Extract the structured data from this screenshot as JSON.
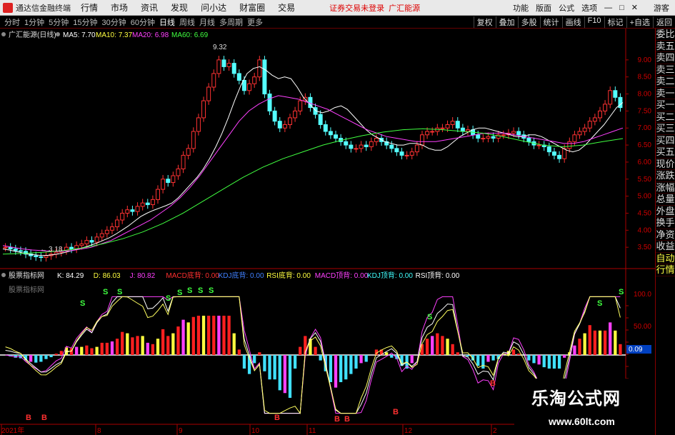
{
  "menubar": {
    "app_title": "通达信金融终端",
    "items": [
      "行情",
      "市场",
      "资讯",
      "发现",
      "问小达",
      "财富圈",
      "交易"
    ],
    "notice": "证券交易未登录",
    "notice2": "广汇能源",
    "right_items": [
      "功能",
      "版面",
      "公式",
      "选项"
    ],
    "guest": "游客"
  },
  "periodbar": {
    "periods": [
      "分时",
      "1分钟",
      "5分钟",
      "15分钟",
      "30分钟",
      "60分钟",
      "日线",
      "周线",
      "月线",
      "多周期",
      "更多"
    ],
    "active": "日线",
    "tools": [
      "复权",
      "叠加",
      "多股",
      "统计",
      "画线",
      "F10",
      "标记",
      "+自选",
      "返回"
    ]
  },
  "main_chart": {
    "stock_label": "广汇能源(日线)",
    "ma": [
      {
        "name": "MA5",
        "value": "7.70",
        "color": "#ffffff"
      },
      {
        "name": "MA10",
        "value": "7.37",
        "color": "#ffff40"
      },
      {
        "name": "MA20",
        "value": "6.98",
        "color": "#ff40ff"
      },
      {
        "name": "MA60",
        "value": "6.69",
        "color": "#40ff40"
      }
    ],
    "high_label": "9.32",
    "low_label": "3.18",
    "y_ticks": [
      "9.00",
      "8.50",
      "8.00",
      "7.50",
      "7.00",
      "6.50",
      "6.00",
      "5.50",
      "5.00",
      "4.50",
      "4.00",
      "3.50"
    ]
  },
  "indicator": {
    "name_label": "股票指标网",
    "sub_label": "股票指标网",
    "values": [
      {
        "text": "K: 84.29",
        "color": "#ffffff"
      },
      {
        "text": "D: 86.03",
        "color": "#ffff40"
      },
      {
        "text": "J: 80.82",
        "color": "#ff40ff"
      },
      {
        "text": "MACD底背: 0.00",
        "color": "#ff3030"
      },
      {
        "text": "KDJ底背: 0.00",
        "color": "#4080ff"
      },
      {
        "text": "RSI底背: 0.00",
        "color": "#ffff40"
      },
      {
        "text": "MACD顶背: 0.00",
        "color": "#ff40ff"
      },
      {
        "text": "KDJ顶背: 0.00",
        "color": "#40ffff"
      },
      {
        "text": "RSI顶背: 0.00",
        "color": "#ffffff"
      }
    ],
    "y_ticks": [
      "100.0",
      "50.00",
      "0.09"
    ]
  },
  "x_axis": [
    "2021年",
    "8",
    "9",
    "10",
    "11",
    "12",
    "2"
  ],
  "side_panel": [
    "委比",
    "卖五",
    "卖四",
    "卖三",
    "卖二",
    "卖一",
    "买一",
    "买二",
    "买三",
    "买四",
    "买五",
    "现价",
    "涨跌",
    "涨幅",
    "总量",
    "外盘",
    "换手",
    "净资",
    "收益",
    "自动",
    "行情"
  ],
  "watermark": {
    "title": "乐淘公式网",
    "url": "www.60lt.com"
  },
  "chart_data": {
    "type": "candlestick",
    "closes": [
      3.5,
      3.45,
      3.4,
      3.38,
      3.3,
      3.25,
      3.22,
      3.2,
      3.25,
      3.3,
      3.35,
      3.4,
      3.5,
      3.45,
      3.55,
      3.6,
      3.7,
      3.65,
      3.8,
      3.9,
      4.0,
      4.1,
      4.3,
      4.5,
      4.6,
      4.55,
      4.7,
      4.8,
      4.75,
      4.9,
      5.2,
      5.5,
      5.4,
      5.6,
      5.8,
      6.2,
      6.4,
      6.9,
      7.3,
      7.8,
      8.2,
      8.6,
      9.0,
      8.8,
      8.9,
      8.6,
      8.4,
      8.1,
      8.3,
      8.5,
      9.0,
      8.0,
      7.5,
      7.2,
      7.0,
      7.1,
      7.3,
      7.5,
      7.8,
      7.9,
      7.6,
      7.4,
      7.1,
      6.9,
      6.8,
      6.7,
      6.6,
      6.5,
      6.4,
      6.4,
      6.5,
      6.45,
      6.6,
      6.7,
      6.6,
      6.5,
      6.4,
      6.3,
      6.2,
      6.2,
      6.3,
      6.5,
      6.8,
      6.9,
      6.9,
      7.0,
      7.0,
      7.1,
      7.2,
      7.0,
      6.9,
      6.95,
      6.8,
      6.7,
      6.7,
      6.75,
      6.7,
      6.8,
      6.8,
      6.85,
      6.9,
      6.8,
      6.7,
      6.6,
      6.5,
      6.5,
      6.45,
      6.3,
      6.2,
      6.1,
      6.4,
      6.6,
      6.8,
      6.9,
      7.0,
      7.2,
      7.3,
      7.5,
      7.7,
      8.1,
      7.9,
      7.6
    ],
    "ma5": [
      3.45,
      3.42,
      3.38,
      3.34,
      3.3,
      3.28,
      3.26,
      3.26,
      3.28,
      3.31,
      3.35,
      3.4,
      3.45,
      3.5,
      3.56,
      3.62,
      3.7,
      3.78,
      3.88,
      4.0,
      4.12,
      4.26,
      4.4,
      4.5,
      4.58,
      4.65,
      4.72,
      4.8,
      4.95,
      5.15,
      5.35,
      5.55,
      5.8,
      6.1,
      6.45,
      6.85,
      7.3,
      7.8,
      8.25,
      8.6,
      8.75,
      8.8,
      8.7,
      8.55,
      8.45,
      8.5,
      8.45,
      8.2,
      7.9,
      7.7,
      7.5,
      7.45,
      7.5,
      7.6,
      7.65,
      7.55,
      7.35,
      7.15,
      6.95,
      6.8,
      6.7,
      6.6,
      6.55,
      6.5,
      6.5,
      6.55,
      6.55,
      6.5,
      6.4,
      6.35,
      6.35,
      6.45,
      6.6,
      6.75,
      6.85,
      6.95,
      7.0,
      7.0,
      6.95,
      6.9,
      6.85,
      6.8,
      6.75,
      6.75,
      6.8,
      6.8,
      6.75,
      6.65,
      6.55,
      6.45,
      6.35,
      6.3,
      6.35,
      6.5,
      6.7,
      6.9,
      7.1,
      7.35,
      7.6,
      7.75
    ],
    "ma20": [
      3.55,
      3.5,
      3.45,
      3.42,
      3.4,
      3.38,
      3.38,
      3.4,
      3.45,
      3.5,
      3.6,
      3.7,
      3.85,
      4.0,
      4.15,
      4.3,
      4.5,
      4.7,
      4.95,
      5.25,
      5.6,
      6.0,
      6.4,
      6.8,
      7.2,
      7.5,
      7.7,
      7.85,
      7.95,
      7.9,
      7.85,
      7.75,
      7.65,
      7.55,
      7.4,
      7.25,
      7.1,
      6.95,
      6.85,
      6.75,
      6.7,
      6.65,
      6.6,
      6.6,
      6.6,
      6.65,
      6.7,
      6.75,
      6.8,
      6.85,
      6.85,
      6.85,
      6.8,
      6.75,
      6.7,
      6.65,
      6.6,
      6.55,
      6.55,
      6.6,
      6.7,
      6.8,
      6.9,
      7.0
    ],
    "ma60": [
      3.3,
      3.32,
      3.35,
      3.4,
      3.48,
      3.6,
      3.75,
      3.95,
      4.2,
      4.5,
      4.85,
      5.2,
      5.55,
      5.85,
      6.1,
      6.3,
      6.5,
      6.65,
      6.78,
      6.88,
      6.95,
      6.98,
      6.95,
      6.9,
      6.85,
      6.75,
      6.62,
      6.5,
      6.45,
      6.5,
      6.6,
      6.69
    ]
  }
}
